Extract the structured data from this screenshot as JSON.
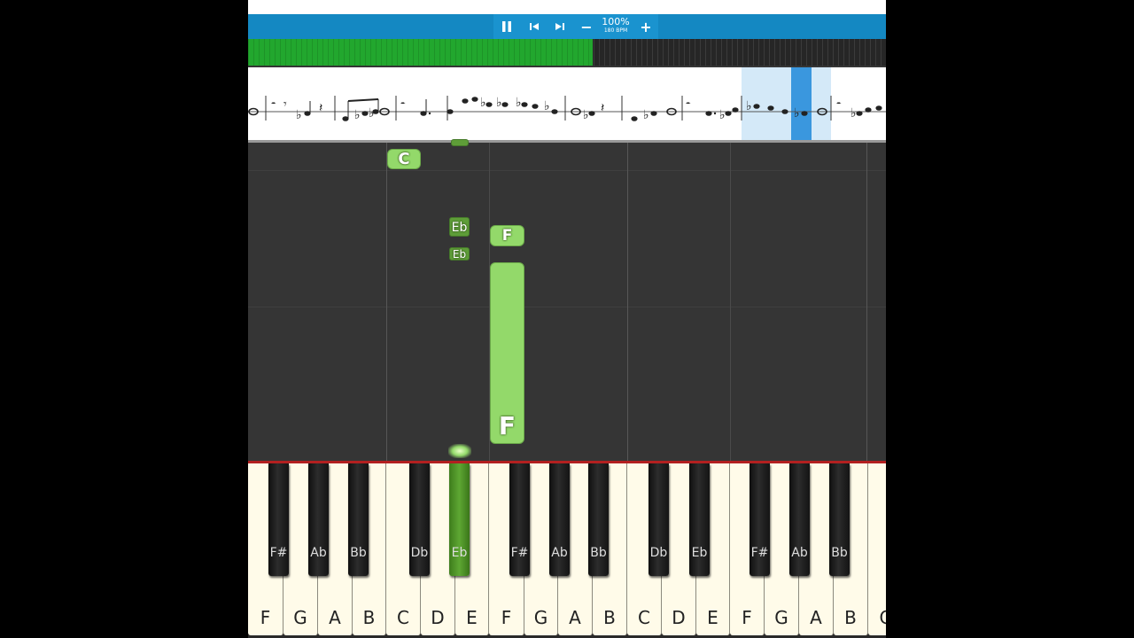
{
  "toolbar": {
    "pause_icon": "pause-icon",
    "prev_icon": "skip-back-icon",
    "next_icon": "skip-forward-icon",
    "zoom_out_label": "−",
    "zoom_in_label": "+",
    "zoom_level": "100%",
    "tempo": "180 BPM",
    "accent": "#1488c2"
  },
  "progress": {
    "fraction": 0.54,
    "color": "#22a72e"
  },
  "falling_notes": [
    {
      "label": "C",
      "style": "big"
    },
    {
      "label": "Eb",
      "style": "small"
    },
    {
      "label": "Eb",
      "style": "small"
    },
    {
      "label": "F",
      "style": "big"
    },
    {
      "label": "F",
      "style": "big"
    }
  ],
  "keyboard": {
    "white_keys": [
      "F",
      "G",
      "A",
      "B",
      "C",
      "D",
      "E",
      "F",
      "G",
      "A",
      "B",
      "C",
      "D",
      "E",
      "F",
      "G",
      "A",
      "B",
      "C"
    ],
    "black_keys": [
      {
        "label": "F#",
        "active": false
      },
      {
        "label": "Ab",
        "active": false
      },
      {
        "label": "Bb",
        "active": false
      },
      {
        "label": "Db",
        "active": false
      },
      {
        "label": "Eb",
        "active": true
      },
      {
        "label": "F#",
        "active": false
      },
      {
        "label": "Ab",
        "active": false
      },
      {
        "label": "Bb",
        "active": false
      },
      {
        "label": "Db",
        "active": false
      },
      {
        "label": "Eb",
        "active": false
      },
      {
        "label": "F#",
        "active": false
      },
      {
        "label": "Ab",
        "active": false
      },
      {
        "label": "Bb",
        "active": false
      }
    ],
    "active_color": "#5ea733"
  }
}
